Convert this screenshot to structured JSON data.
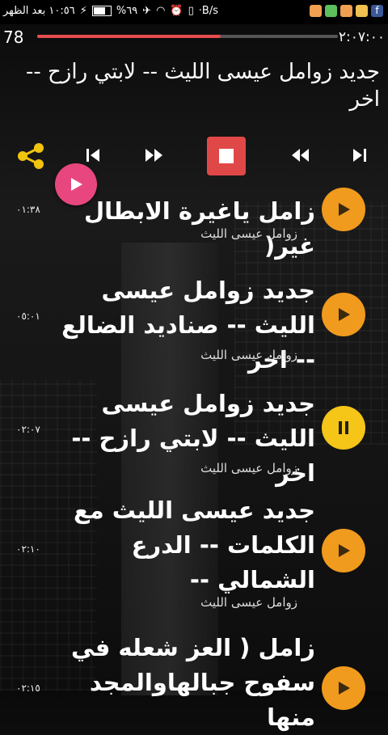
{
  "status": {
    "left_text": "١٠:٥٦ بعد الظهر",
    "battery": "%٦٩",
    "net_speed": "·B/s"
  },
  "player": {
    "elapsed": "78",
    "duration": "٢:٠٧:٠٠",
    "progress": 0.61,
    "title": "جديد زوامل عيسى الليث -- لابتي رازح -- اخر"
  },
  "tracks": [
    {
      "title": "زامل ياغيرة الابطال غير(",
      "artist": "زوامل عيسى الليث",
      "time": "٠١:٣٨",
      "state": "play"
    },
    {
      "title": "جديد زوامل عيسى الليث -- صناديد الضالع -- اخر",
      "artist": "زوامل عيسى الليث",
      "time": "٠٥:٠١",
      "state": "play"
    },
    {
      "title": "جديد زوامل عيسى الليث -- لابتي رازح -- اخر",
      "artist": "زوامل عيسى الليث",
      "time": "٠٢:٠٧",
      "state": "pause"
    },
    {
      "title": "جديد عيسى الليث مع الكلمات -- الدرع الشمالي --",
      "artist": "زوامل عيسى الليث",
      "time": "٠٢:١٠",
      "state": "play"
    },
    {
      "title": "زامل ( العز شعله في سفوح جبالهاوالمجد منها",
      "artist": "",
      "time": "٠٢:١٥",
      "state": "play"
    }
  ],
  "colors": {
    "accent": "#e04848",
    "play": "#f09a1e",
    "pause": "#f5c518",
    "fab": "#e8467f"
  }
}
